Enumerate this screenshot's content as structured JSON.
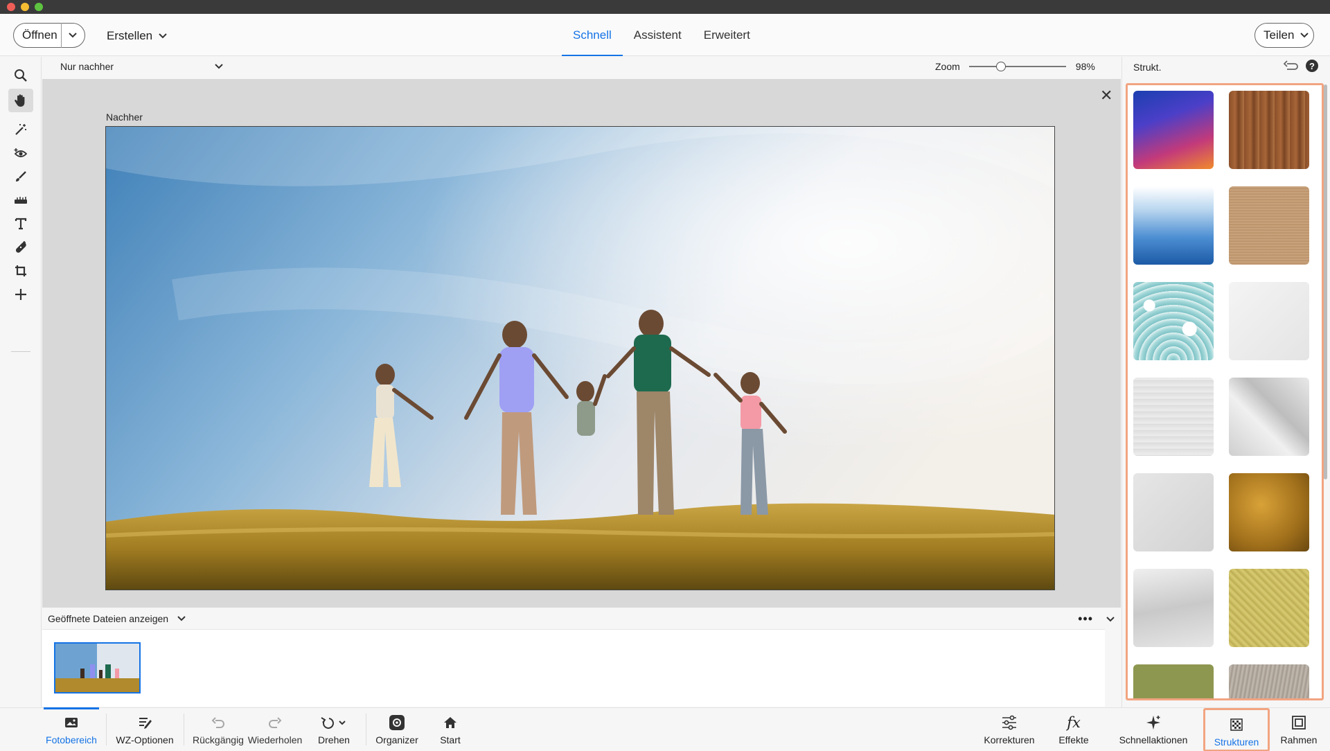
{
  "window": {
    "traffic_lights": [
      "close",
      "minimize",
      "zoom"
    ]
  },
  "topbar": {
    "open_label": "Öffnen",
    "create_label": "Erstellen",
    "share_label": "Teilen",
    "modes": [
      {
        "label": "Schnell",
        "active": true
      },
      {
        "label": "Assistent",
        "active": false
      },
      {
        "label": "Erweitert",
        "active": false
      }
    ]
  },
  "toolbar": {
    "tools": [
      "zoom-icon",
      "hand-icon",
      "magic-wand-icon",
      "red-eye-icon",
      "whiten-teeth-icon",
      "straighten-icon",
      "text-icon",
      "spot-healing-icon",
      "crop-icon",
      "move-icon"
    ],
    "active_tool": "hand-icon"
  },
  "options": {
    "view_select": "Nur nachher",
    "zoom_label": "Zoom",
    "zoom_value": "98%",
    "zoom_fraction": 0.33
  },
  "canvas": {
    "view_label": "Nachher"
  },
  "photo_bin": {
    "header": "Geöffnete Dateien anzeigen",
    "more": "•••"
  },
  "right_panel": {
    "title": "Strukt.",
    "help": "?",
    "textures": [
      "gradient-blue-orange",
      "wood-grain",
      "blue-polygon",
      "burlap",
      "wave-pattern",
      "white-paper",
      "brick-wall",
      "crumpled-paper",
      "concrete",
      "gold-foil",
      "peeling-paint",
      "yellow-fabric",
      "green-texture",
      "grey-fur"
    ]
  },
  "taskbar": {
    "left": [
      {
        "label": "Fotobereich",
        "icon": "photo-bin-icon"
      },
      {
        "label": "WZ-Optionen",
        "icon": "tool-options-icon"
      },
      {
        "label": "Rückgängig",
        "icon": "undo-icon"
      },
      {
        "label": "Wiederholen",
        "icon": "redo-icon"
      },
      {
        "label": "Drehen",
        "icon": "rotate-icon"
      },
      {
        "label": "Organizer",
        "icon": "organizer-icon"
      },
      {
        "label": "Start",
        "icon": "home-icon"
      }
    ],
    "right": [
      {
        "label": "Korrekturen",
        "icon": "adjustments-icon"
      },
      {
        "label": "Effekte",
        "icon": "effects-icon"
      },
      {
        "label": "Schnellaktionen",
        "icon": "quick-actions-icon"
      },
      {
        "label": "Strukturen",
        "icon": "textures-icon"
      },
      {
        "label": "Rahmen",
        "icon": "frames-icon"
      }
    ]
  },
  "colors": {
    "accent": "#1473e6",
    "highlight": "#f2a481"
  }
}
